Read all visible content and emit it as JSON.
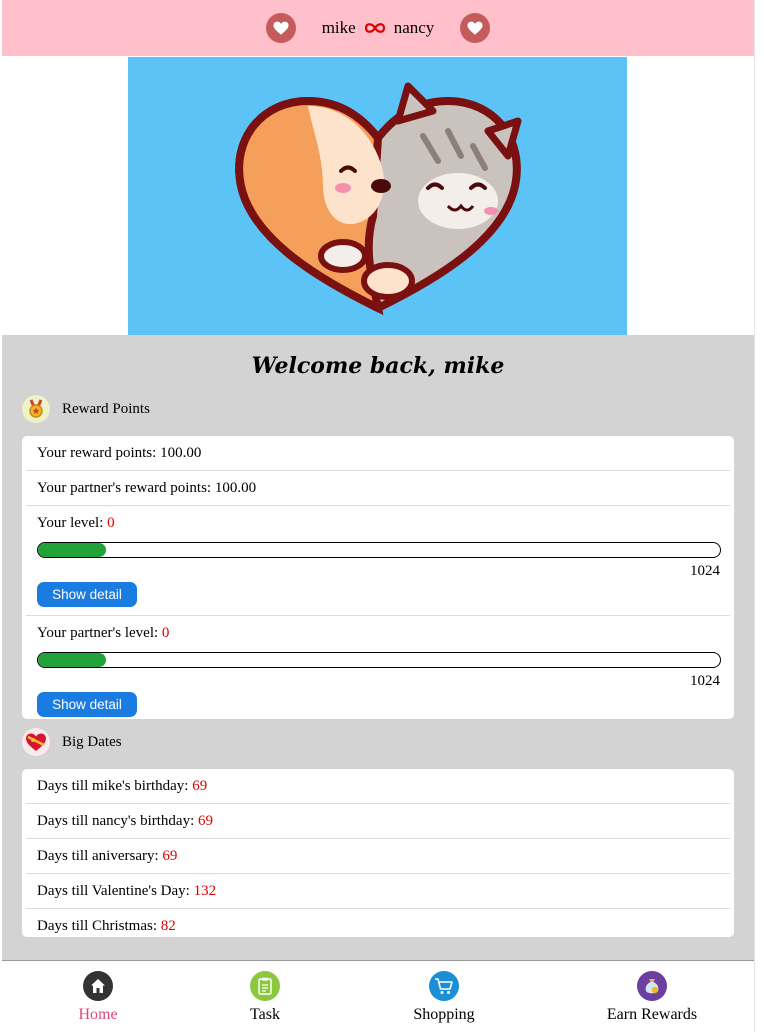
{
  "header": {
    "partner1": "mike",
    "partner2": "nancy",
    "heart_icon": "heart-icon",
    "link_icon": "infinity-icon"
  },
  "banner": {
    "image": "dog-and-cat-heart-illustration",
    "background": "#5bc3f5"
  },
  "welcome": "Welcome back, mike",
  "reward": {
    "title": "Reward Points",
    "icon": "medal-icon",
    "your_points_label": "Your reward points: ",
    "your_points": "100.00",
    "partner_points_label": "Your partner's reward points: ",
    "partner_points": "100.00",
    "your_level_label": "Your level: ",
    "your_level": "0",
    "your_progress_max": "1024",
    "your_progress_fraction": 0.1,
    "partner_level_label": "Your partner's level: ",
    "partner_level": "0",
    "partner_progress_max": "1024",
    "partner_progress_fraction": 0.1,
    "show_detail": "Show detail"
  },
  "dates": {
    "title": "Big Dates",
    "icon": "heart-gift-icon",
    "items": [
      {
        "label": "Days till mike's birthday: ",
        "value": "69"
      },
      {
        "label": "Days till nancy's birthday: ",
        "value": "69"
      },
      {
        "label": "Days till aniversary: ",
        "value": "69"
      },
      {
        "label": "Days till Valentine's Day: ",
        "value": "132"
      },
      {
        "label": "Days till Christmas: ",
        "value": "82"
      }
    ]
  },
  "nav": {
    "items": [
      {
        "label": "Home",
        "icon": "home-icon",
        "active": true
      },
      {
        "label": "Task",
        "icon": "clipboard-icon",
        "active": false
      },
      {
        "label": "Shopping",
        "icon": "cart-icon",
        "active": false
      },
      {
        "label": "Earn Rewards",
        "icon": "money-bag-icon",
        "active": false
      }
    ]
  },
  "colors": {
    "header_bg": "#ffc0cb",
    "content_bg": "#d3d3d3",
    "accent_red": "#e00000",
    "progress_green": "#21a33a",
    "button_blue": "#1a7be0",
    "active_nav": "#e0467c"
  }
}
